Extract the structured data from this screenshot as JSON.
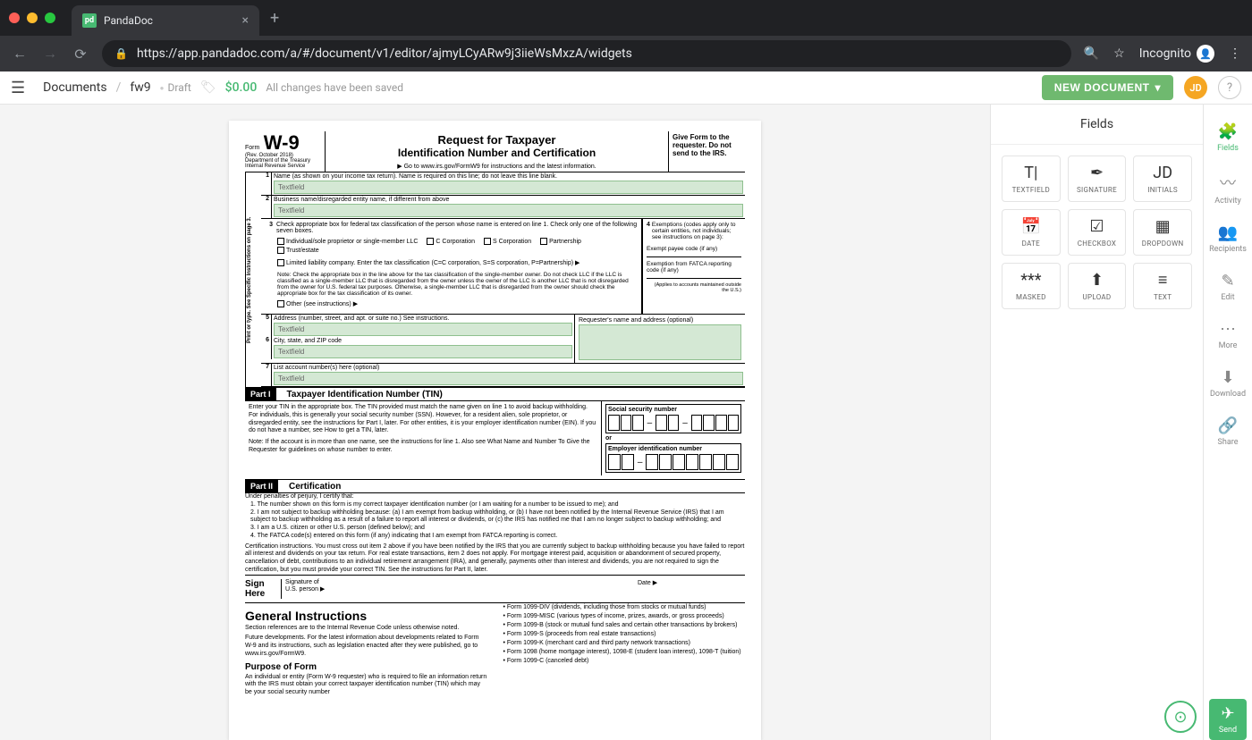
{
  "browser": {
    "tab_title": "PandaDoc",
    "url": "https://app.pandadoc.com/a/#/document/v1/editor/ajmyLCyARw9j3iieWsMxzA/widgets",
    "incognito": "Incognito"
  },
  "header": {
    "breadcrumb_root": "Documents",
    "breadcrumb_doc": "fw9",
    "status": "Draft",
    "price": "$0.00",
    "saved": "All changes have been saved",
    "new_doc": "NEW DOCUMENT",
    "avatar": "JD",
    "help": "?"
  },
  "fields_panel": {
    "title": "Fields",
    "tiles": [
      {
        "icon": "T|",
        "label": "TEXTFIELD"
      },
      {
        "icon": "✒",
        "label": "SIGNATURE"
      },
      {
        "icon": "JD",
        "label": "INITIALS"
      },
      {
        "icon": "📅",
        "label": "DATE"
      },
      {
        "icon": "☑",
        "label": "CHECKBOX"
      },
      {
        "icon": "▦",
        "label": "DROPDOWN"
      },
      {
        "icon": "***",
        "label": "MASKED"
      },
      {
        "icon": "⬆",
        "label": "UPLOAD"
      },
      {
        "icon": "≡",
        "label": "TEXT"
      }
    ]
  },
  "rail": [
    {
      "icon": "🧩",
      "label": "Fields",
      "active": true
    },
    {
      "icon": "〰",
      "label": "Activity"
    },
    {
      "icon": "👥",
      "label": "Recipients"
    },
    {
      "icon": "✎",
      "label": "Edit"
    },
    {
      "icon": "⋯",
      "label": "More"
    },
    {
      "icon": "⬇",
      "label": "Download"
    },
    {
      "icon": "🔗",
      "label": "Share"
    }
  ],
  "rail_send": "Send",
  "w9": {
    "form": "Form",
    "name": "W-9",
    "rev": "(Rev. October 2018)",
    "dept": "Department of the Treasury",
    "irs": "Internal Revenue Service",
    "title1": "Request for Taxpayer",
    "title2": "Identification Number and Certification",
    "goto": "▶ Go to www.irs.gov/FormW9 for instructions and the latest information.",
    "give": "Give Form to the requester. Do not send to the IRS.",
    "sidelabel": "Print or type.\nSee Specific Instructions on page 3.",
    "row1": "Name (as shown on your income tax return). Name is required on this line; do not leave this line blank.",
    "row2": "Business name/disregarded entity name, if different from above",
    "row3": "Check appropriate box for federal tax classification of the person whose name is entered on line 1. Check only one of the following seven boxes.",
    "cb1": "Individual/sole proprietor or single-member LLC",
    "cb2": "C Corporation",
    "cb3": "S Corporation",
    "cb4": "Partnership",
    "cb5": "Trust/estate",
    "cb6": "Limited liability company. Enter the tax classification (C=C corporation, S=S corporation, P=Partnership) ▶",
    "cb7": "Other (see instructions) ▶",
    "note3": "Note: Check the appropriate box in the line above for the tax classification of the single-member owner. Do not check LLC if the LLC is classified as a single-member LLC that is disregarded from the owner unless the owner of the LLC is another LLC that is not disregarded from the owner for U.S. federal tax purposes. Otherwise, a single-member LLC that is disregarded from the owner should check the appropriate box for the tax classification of its owner.",
    "row4": "Exemptions (codes apply only to certain entities, not individuals; see instructions on page 3):",
    "row4a": "Exempt payee code (if any)",
    "row4b": "Exemption from FATCA reporting code (if any)",
    "row4c": "(Applies to accounts maintained outside the U.S.)",
    "row5": "Address (number, street, and apt. or suite no.) See instructions.",
    "row5r": "Requester's name and address (optional)",
    "row6": "City, state, and ZIP code",
    "row7": "List account number(s) here (optional)",
    "tf": "Textfield",
    "part1": "Part I",
    "part1_title": "Taxpayer Identification Number (TIN)",
    "part1_text": "Enter your TIN in the appropriate box. The TIN provided must match the name given on line 1 to avoid backup withholding. For individuals, this is generally your social security number (SSN). However, for a resident alien, sole proprietor, or disregarded entity, see the instructions for Part I, later. For other entities, it is your employer identification number (EIN). If you do not have a number, see How to get a TIN, later.",
    "part1_note": "Note: If the account is in more than one name, see the instructions for line 1. Also see What Name and Number To Give the Requester for guidelines on whose number to enter.",
    "ssn_label": "Social security number",
    "or": "or",
    "ein_label": "Employer identification number",
    "part2": "Part II",
    "part2_title": "Certification",
    "cert_intro": "Under penalties of perjury, I certify that:",
    "cert1": "1. The number shown on this form is my correct taxpayer identification number (or I am waiting for a number to be issued to me); and",
    "cert2": "2. I am not subject to backup withholding because: (a) I am exempt from backup withholding, or (b) I have not been notified by the Internal Revenue Service (IRS) that I am subject to backup withholding as a result of a failure to report all interest or dividends, or (c) the IRS has notified me that I am no longer subject to backup withholding; and",
    "cert3": "3. I am a U.S. citizen or other U.S. person (defined below); and",
    "cert4": "4. The FATCA code(s) entered on this form (if any) indicating that I am exempt from FATCA reporting is correct.",
    "cert_inst": "Certification instructions. You must cross out item 2 above if you have been notified by the IRS that you are currently subject to backup withholding because you have failed to report all interest and dividends on your tax return. For real estate transactions, item 2 does not apply. For mortgage interest paid, acquisition or abandonment of secured property, cancellation of debt, contributions to an individual retirement arrangement (IRA), and generally, payments other than interest and dividends, you are not required to sign the certification, but you must provide your correct TIN. See the instructions for Part II, later.",
    "sign_here": "Sign\nHere",
    "sig_of": "Signature of\nU.S. person ▶",
    "date": "Date ▶",
    "gi_title": "General Instructions",
    "gi_1": "Section references are to the Internal Revenue Code unless otherwise noted.",
    "gi_2": "Future developments. For the latest information about developments related to Form W-9 and its instructions, such as legislation enacted after they were published, go to www.irs.gov/FormW9.",
    "purpose": "Purpose of Form",
    "purpose_text": "An individual or entity (Form W-9 requester) who is required to file an information return with the IRS must obtain your correct taxpayer identification number (TIN) which may be your social security number",
    "b1": "• Form 1099-DIV (dividends, including those from stocks or mutual funds)",
    "b2": "• Form 1099-MISC (various types of income, prizes, awards, or gross proceeds)",
    "b3": "• Form 1099-B (stock or mutual fund sales and certain other transactions by brokers)",
    "b4": "• Form 1099-S (proceeds from real estate transactions)",
    "b5": "• Form 1099-K (merchant card and third party network transactions)",
    "b6": "• Form 1098 (home mortgage interest), 1098-E (student loan interest), 1098-T (tuition)",
    "b7": "• Form 1099-C (canceled debt)"
  }
}
